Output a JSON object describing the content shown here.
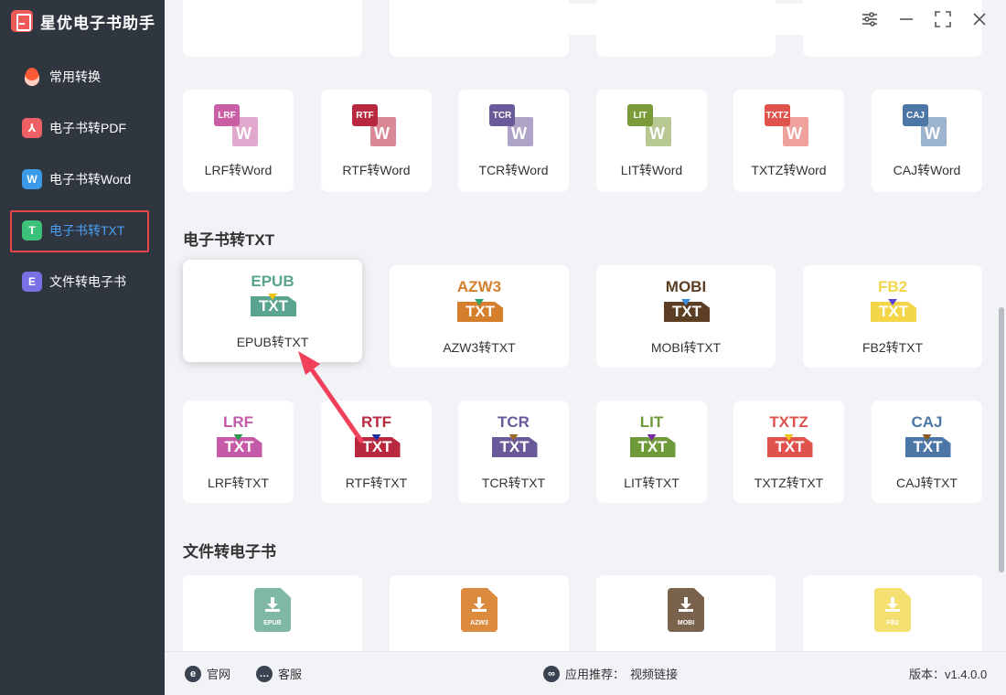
{
  "app": {
    "title": "星优电子书助手"
  },
  "sidebar": {
    "items": [
      {
        "label": "常用转换",
        "icon": "fire-icon",
        "active": false
      },
      {
        "label": "电子书转PDF",
        "icon": "pdf-icon",
        "icon_glyph": "⅄",
        "active": false
      },
      {
        "label": "电子书转Word",
        "icon": "word-icon",
        "icon_glyph": "W",
        "active": false
      },
      {
        "label": "电子书转TXT",
        "icon": "txt-icon",
        "icon_glyph": "T",
        "active": true
      },
      {
        "label": "文件转电子书",
        "icon": "ebook-icon",
        "icon_glyph": "E",
        "active": false
      }
    ]
  },
  "window_controls": {
    "settings": "⚙",
    "minimize": "—",
    "maximize": "⛶",
    "close": "✕"
  },
  "word_cards": [
    {
      "label": "LRF转Word",
      "badge": "LRF",
      "color": "#c95ea4"
    },
    {
      "label": "RTF转Word",
      "badge": "RTF",
      "color": "#b8283e"
    },
    {
      "label": "TCR转Word",
      "badge": "TCR",
      "color": "#6a5a9a"
    },
    {
      "label": "LIT转Word",
      "badge": "LIT",
      "color": "#7b9a3a"
    },
    {
      "label": "TXTZ转Word",
      "badge": "TXTZ",
      "color": "#e0534c"
    },
    {
      "label": "CAJ转Word",
      "badge": "CAJ",
      "color": "#4b76a6"
    }
  ],
  "txt_section": {
    "title": "电子书转TXT",
    "row1": [
      {
        "label": "EPUB转TXT",
        "format": "EPUB",
        "box": "TXT",
        "color": "#5aa58f",
        "arrow": "#f2c417",
        "highlighted": true
      },
      {
        "label": "AZW3转TXT",
        "format": "AZW3",
        "box": "TXT",
        "color": "#d57f2c",
        "arrow": "#2aa36a",
        "highlighted": false
      },
      {
        "label": "MOBI转TXT",
        "format": "MOBI",
        "box": "TXT",
        "color": "#5b3e23",
        "arrow": "#3a8fe0",
        "highlighted": false
      },
      {
        "label": "FB2转TXT",
        "format": "FB2",
        "box": "TXT",
        "color": "#f3d64a",
        "arrow": "#5a46d8",
        "highlighted": false
      }
    ],
    "row2": [
      {
        "label": "LRF转TXT",
        "format": "LRF",
        "box": "TXT",
        "color": "#c55aa8",
        "arrow": "#2a9a4a"
      },
      {
        "label": "RTF转TXT",
        "format": "RTF",
        "box": "TXT",
        "color": "#b8283e",
        "arrow": "#1f2ea0"
      },
      {
        "label": "TCR转TXT",
        "format": "TCR",
        "box": "TXT",
        "color": "#6a5a9a",
        "arrow": "#9a6a20"
      },
      {
        "label": "LIT转TXT",
        "format": "LIT",
        "box": "TXT",
        "color": "#6f9a3a",
        "arrow": "#7a2aa0"
      },
      {
        "label": "TXTZ转TXT",
        "format": "TXTZ",
        "box": "TXT",
        "color": "#e0534c",
        "arrow": "#f2c417"
      },
      {
        "label": "CAJ转TXT",
        "format": "CAJ",
        "box": "TXT",
        "color": "#4b76a6",
        "arrow": "#8a5a20"
      }
    ]
  },
  "ebook_section": {
    "title": "文件转电子书",
    "items": [
      {
        "tag": "EPUB",
        "color": "#7fb8a6"
      },
      {
        "tag": "AZW3",
        "color": "#dc8a3e"
      },
      {
        "tag": "MOBI",
        "color": "#7a634c"
      },
      {
        "tag": "FB2",
        "color": "#f3e070"
      }
    ]
  },
  "footer": {
    "website": "官网",
    "support": "客服",
    "recommend_label": "应用推荐：",
    "recommend_link": "视频链接",
    "version": "版本：v1.4.0.0"
  },
  "annotation_color": "#f0405a"
}
